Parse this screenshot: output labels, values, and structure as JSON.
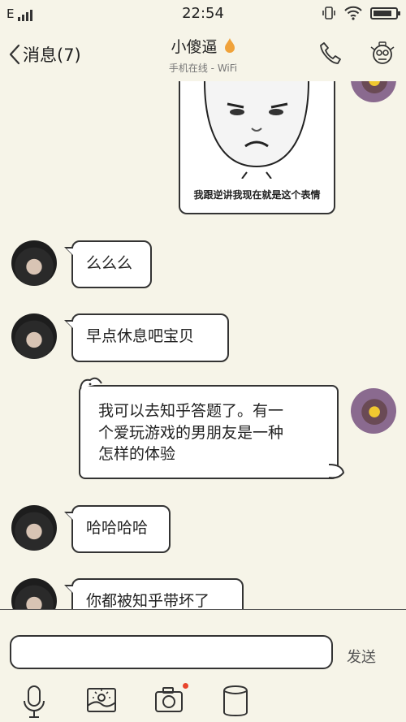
{
  "status_bar": {
    "carrier": "E",
    "time": "22:54"
  },
  "header": {
    "back_label": "消息(7)",
    "contact_name": "小傻逼",
    "contact_status": "手机在线 - WiFi"
  },
  "messages": [
    {
      "sender": "me",
      "type": "sticker",
      "caption": "我跟逆讲我现在就是这个表情"
    },
    {
      "sender": "friend",
      "type": "text",
      "text": "么么么"
    },
    {
      "sender": "friend",
      "type": "text",
      "text": "早点休息吧宝贝"
    },
    {
      "sender": "me",
      "type": "text",
      "lines": [
        "我可以去知乎答题了。有一",
        "个爱玩游戏的男朋友是一种",
        "怎样的体验"
      ]
    },
    {
      "sender": "friend",
      "type": "text",
      "text": "哈哈哈哈"
    },
    {
      "sender": "friend",
      "type": "text",
      "text": "你都被知乎带坏了"
    }
  ],
  "composer": {
    "input_value": "",
    "send_label": "发送"
  },
  "toolbar": {
    "icons": [
      "microphone-icon",
      "image-icon",
      "camera-icon",
      "more-icon"
    ],
    "camera_badge_color": "#e8452c"
  },
  "colors": {
    "background": "#f6f4e8",
    "bubble": "#ffffff",
    "outline": "#333333",
    "flame": "#f0a23a"
  }
}
